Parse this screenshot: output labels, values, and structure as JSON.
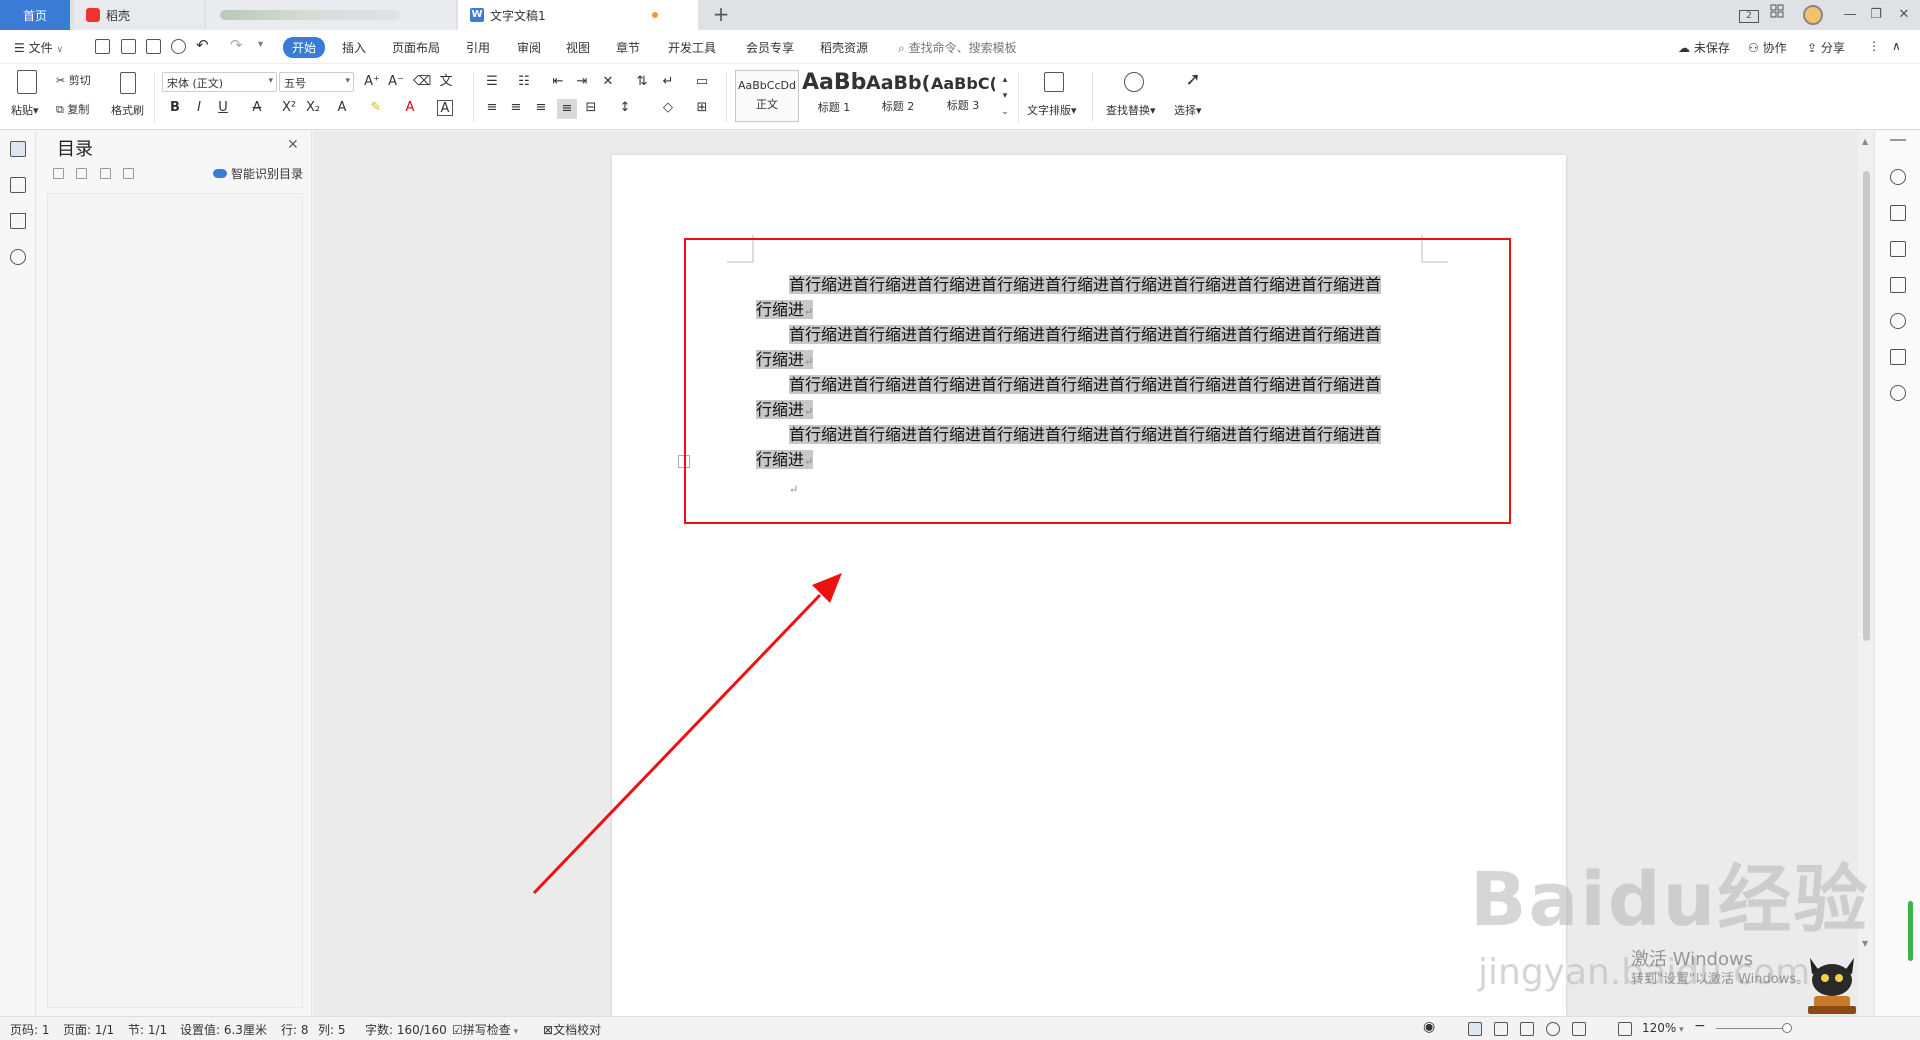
{
  "tabs": {
    "home": "首页",
    "daoke": "稻壳",
    "document": "文字文稿1",
    "new_tab": "+"
  },
  "window": {
    "badge": "2",
    "minimize": "—",
    "restore": "❐",
    "close": "✕"
  },
  "menu": {
    "file": "文件",
    "items": [
      "开始",
      "插入",
      "页面布局",
      "引用",
      "审阅",
      "视图",
      "章节",
      "开发工具",
      "会员专享",
      "稻壳资源"
    ],
    "search_hint": "查找命令、搜索模板",
    "unsaved": "未保存",
    "collaborate": "协作",
    "share": "分享"
  },
  "ribbon": {
    "paste": "粘贴",
    "cut": "剪切",
    "copy": "复制",
    "format_painter": "格式刷",
    "font_name": "宋体 (正文)",
    "font_size": "五号",
    "styles": [
      {
        "sample": "AaBbCcDd",
        "label": "正文"
      },
      {
        "sample": "AaBb",
        "label": "标题 1"
      },
      {
        "sample": "AaBb(",
        "label": "标题 2"
      },
      {
        "sample": "AaBbC(",
        "label": "标题 3"
      }
    ],
    "text_layout": "文字排版",
    "find_replace": "查找替换",
    "select": "选择"
  },
  "nav": {
    "title": "目录",
    "smart_toc": "智能识别目录",
    "close": "✕"
  },
  "document": {
    "paragraphs": [
      {
        "line1": "首行缩进首行缩进首行缩进首行缩进首行缩进首行缩进首行缩进首行缩进首行缩进首",
        "line2": "行缩进"
      },
      {
        "line1": "首行缩进首行缩进首行缩进首行缩进首行缩进首行缩进首行缩进首行缩进首行缩进首",
        "line2": "行缩进"
      },
      {
        "line1": "首行缩进首行缩进首行缩进首行缩进首行缩进首行缩进首行缩进首行缩进首行缩进首",
        "line2": "行缩进"
      },
      {
        "line1": "首行缩进首行缩进首行缩进首行缩进首行缩进首行缩进首行缩进首行缩进首行缩进首",
        "line2": "行缩进"
      }
    ],
    "para_mark": "↵"
  },
  "status": {
    "page_num": "页码: 1",
    "page": "页面: 1/1",
    "section": "节: 1/1",
    "setting": "设置值: 6.3厘米",
    "row": "行: 8",
    "col": "列: 5",
    "words": "字数: 160/160",
    "spell": "拼写检查",
    "proof": "文档校对",
    "zoom": "120%"
  },
  "watermark": {
    "baidu": "Baidu经验",
    "jingyan": "jingyan.baidu.com",
    "windows_line1": "激活 Windows",
    "windows_line2": "转到\"设置\"以激活 Windows。"
  },
  "colors": {
    "accent": "#3a7bd5",
    "highlight_box": "#e11111",
    "arrow": "#e11111",
    "selection": "#c8c8c8"
  }
}
